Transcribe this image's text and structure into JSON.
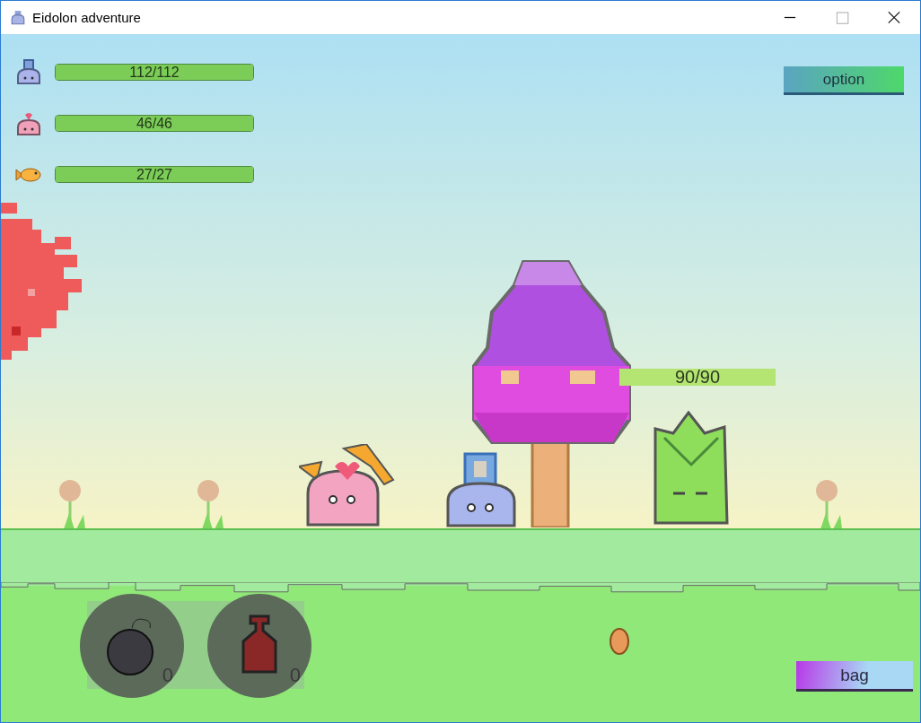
{
  "window": {
    "title": "Eidolon adventure"
  },
  "party": [
    {
      "kind": "slime",
      "level": 1,
      "reading": "112/112"
    },
    {
      "kind": "pinkslime",
      "level": 1,
      "reading": "46/46"
    },
    {
      "kind": "fish",
      "level": 1,
      "reading": "27/27"
    }
  ],
  "option_button": "option",
  "enemy": {
    "level": 1,
    "reading": "90/90"
  },
  "items": [
    {
      "kind": "bomb",
      "count": "0"
    },
    {
      "kind": "potion",
      "count": "0"
    }
  ],
  "bag_button": "bag"
}
